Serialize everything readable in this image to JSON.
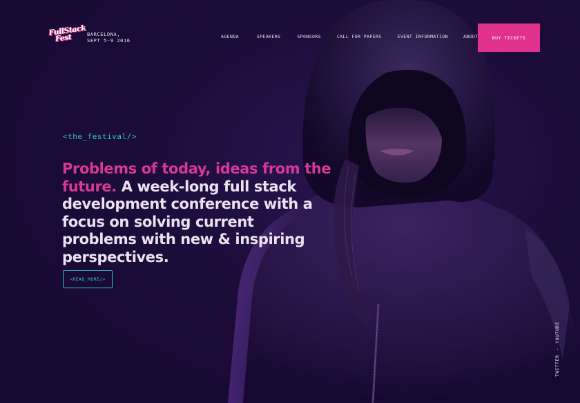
{
  "brand": {
    "logo_line1": "FullStack",
    "logo_line2": "Fest",
    "location_line1": "BARCELONA,",
    "location_line2": "SEPT 5-9 2016"
  },
  "nav": {
    "items": [
      {
        "label": "AGENDA"
      },
      {
        "label": "SPEAKERS"
      },
      {
        "label": "SPONSORS"
      },
      {
        "label": "CALL FOR PAPERS"
      },
      {
        "label": "EVENT INFORMATION"
      },
      {
        "label": "ABOUT"
      }
    ],
    "cta_label": "BUY TICKETS"
  },
  "hero": {
    "tag": "<the_festival/>",
    "headline_accent": "Problems of today, ideas from the future.",
    "headline_rest": " A week-long full stack development conference with a focus on solving current problems with new & inspiring perspectives.",
    "read_more_label": "<READ_MORE/>"
  },
  "social": {
    "twitter_label": "TWITTER",
    "separator": "-",
    "youtube_label": "YOUTUBE"
  },
  "colors": {
    "background": "#1a0b33",
    "accent_pink": "#e0318d",
    "accent_teal": "#2bc9bd",
    "text_light": "#e9e3ef"
  }
}
